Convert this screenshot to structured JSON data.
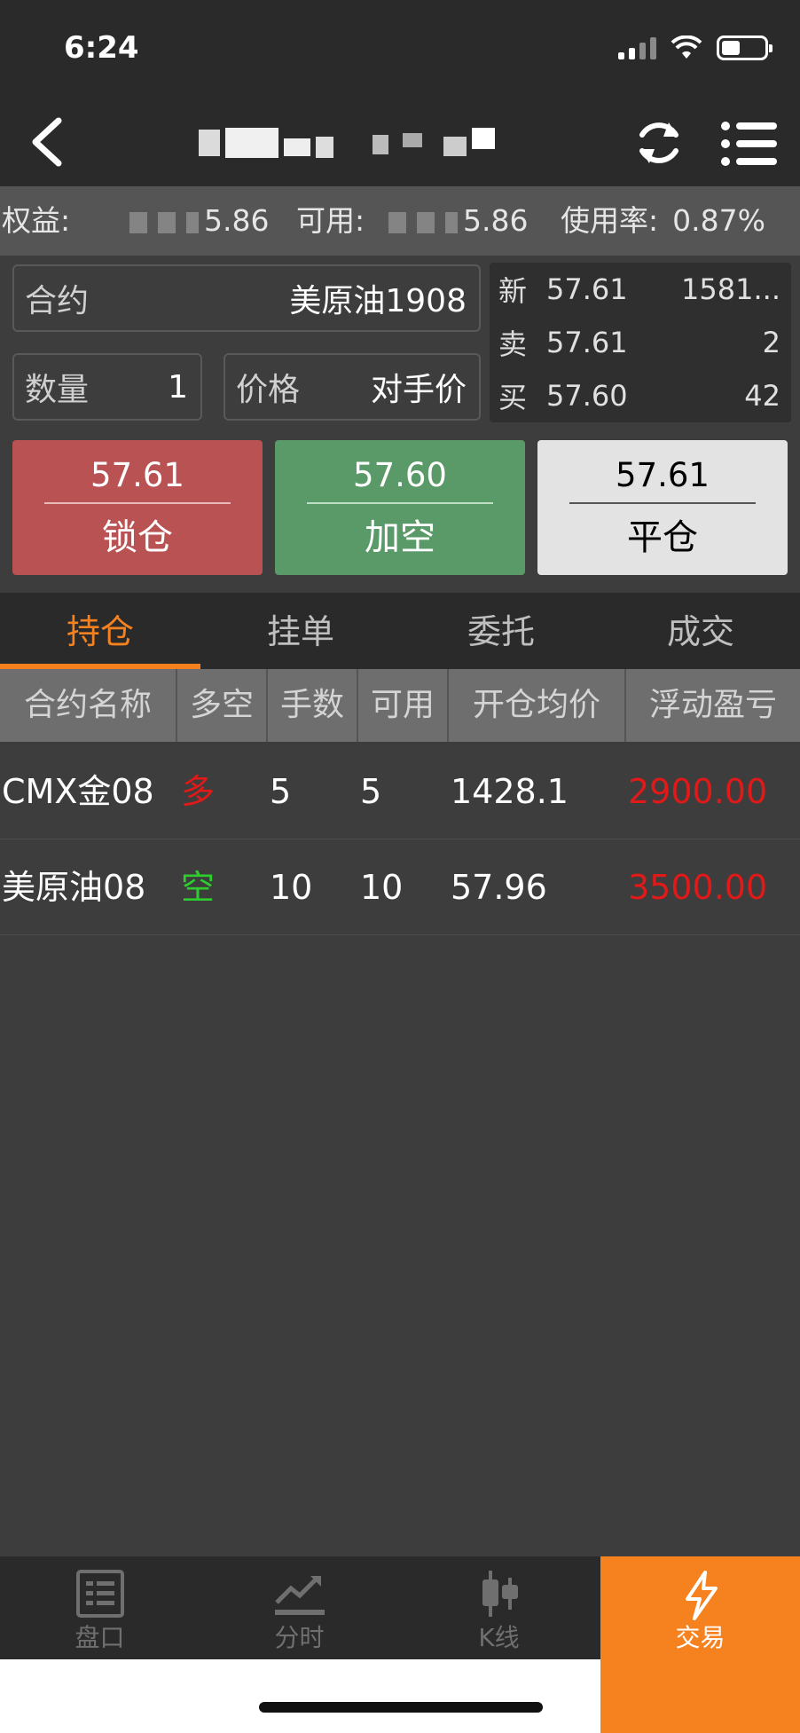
{
  "status_bar": {
    "time": "6:24"
  },
  "header": {
    "title": ""
  },
  "account": {
    "equity_label": "权益:",
    "equity_value_fragment": "5.86",
    "available_label": "可用:",
    "available_value_fragment": "5.86",
    "usage_label": "使用率:",
    "usage_value": "0.87%"
  },
  "order_form": {
    "contract_label": "合约",
    "contract_value": "美原油1908",
    "quantity_label": "数量",
    "quantity_value": "1",
    "price_label": "价格",
    "price_value": "对手价"
  },
  "quote": {
    "rows": [
      {
        "key": "新",
        "price": "57.61",
        "vol": "1581..."
      },
      {
        "key": "卖",
        "price": "57.61",
        "vol": "2"
      },
      {
        "key": "买",
        "price": "57.60",
        "vol": "42"
      }
    ]
  },
  "trade_buttons": {
    "lock": {
      "price": "57.61",
      "label": "锁仓"
    },
    "short": {
      "price": "57.60",
      "label": "加空"
    },
    "close": {
      "price": "57.61",
      "label": "平仓"
    }
  },
  "tabs": [
    "持仓",
    "挂单",
    "委托",
    "成交"
  ],
  "positions": {
    "headers": [
      "合约名称",
      "多空",
      "手数",
      "可用",
      "开仓均价",
      "浮动盈亏"
    ],
    "rows": [
      {
        "name": "CMX金08",
        "side": "多",
        "lots": "5",
        "avail": "5",
        "avg_price": "1428.1",
        "pnl": "2900.00"
      },
      {
        "name": "美原油08",
        "side": "空",
        "lots": "10",
        "avail": "10",
        "avg_price": "57.96",
        "pnl": "3500.00"
      }
    ]
  },
  "bottom_nav": [
    "盘口",
    "分时",
    "K线",
    "交易"
  ],
  "colors": {
    "accent": "#f5821f",
    "lock_button": "#b85253",
    "short_button": "#5a9a68",
    "close_button": "#e3e3e3",
    "profit": "#e01919",
    "long": "#e01919",
    "short": "#2ccd2c"
  },
  "icons": {
    "back": "chevron-left-icon",
    "refresh": "refresh-icon",
    "menu": "list-menu-icon",
    "nav_quote": "order-book-icon",
    "nav_timeshare": "trend-line-icon",
    "nav_kline": "candlestick-icon",
    "nav_trade": "lightning-icon"
  }
}
